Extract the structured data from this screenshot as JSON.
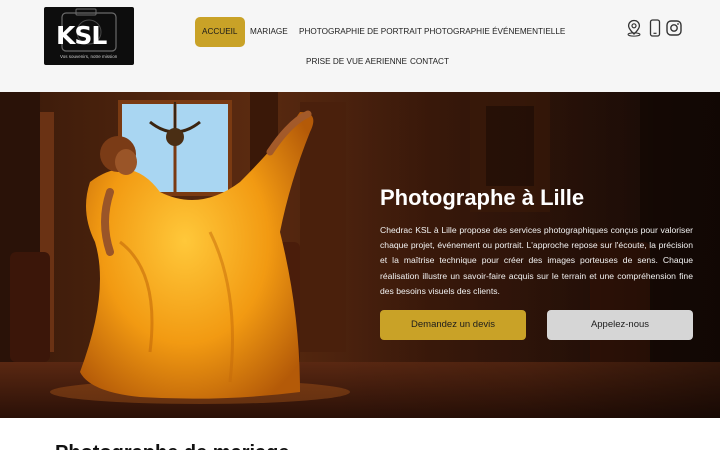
{
  "logo": {
    "word": "KSL",
    "tagline": "Vos souvenirs, notre mission"
  },
  "nav": {
    "items": [
      {
        "label": "Accueil",
        "active": true
      },
      {
        "label": "Mariage"
      },
      {
        "label": "Photographie de portrait"
      },
      {
        "label": "Photographie événementielle"
      },
      {
        "label": "Prise de vue aerienne"
      },
      {
        "label": "Contact"
      }
    ]
  },
  "social": {
    "icons": [
      "location-pin-icon",
      "phone-icon",
      "instagram-icon"
    ]
  },
  "hero": {
    "title": "Photographe à Lille",
    "text": "Chedrac KSL à Lille propose des services photographiques conçus pour valoriser chaque projet, événement ou portrait. L'approche repose sur l'écoute, la précision et la maîtrise technique pour créer des images porteuses de sens. Chaque réalisation illustre un savoir-faire acquis sur le terrain et une compréhension fine des besoins visuels des clients.",
    "quote_button": "Demandez un devis",
    "call_button": "Appelez-nous"
  },
  "section": {
    "title": "Photographe de mariage"
  },
  "colors": {
    "accent": "#c9a227",
    "secondary_button": "#d6d6d6",
    "header_bg": "#f6f6f6"
  }
}
